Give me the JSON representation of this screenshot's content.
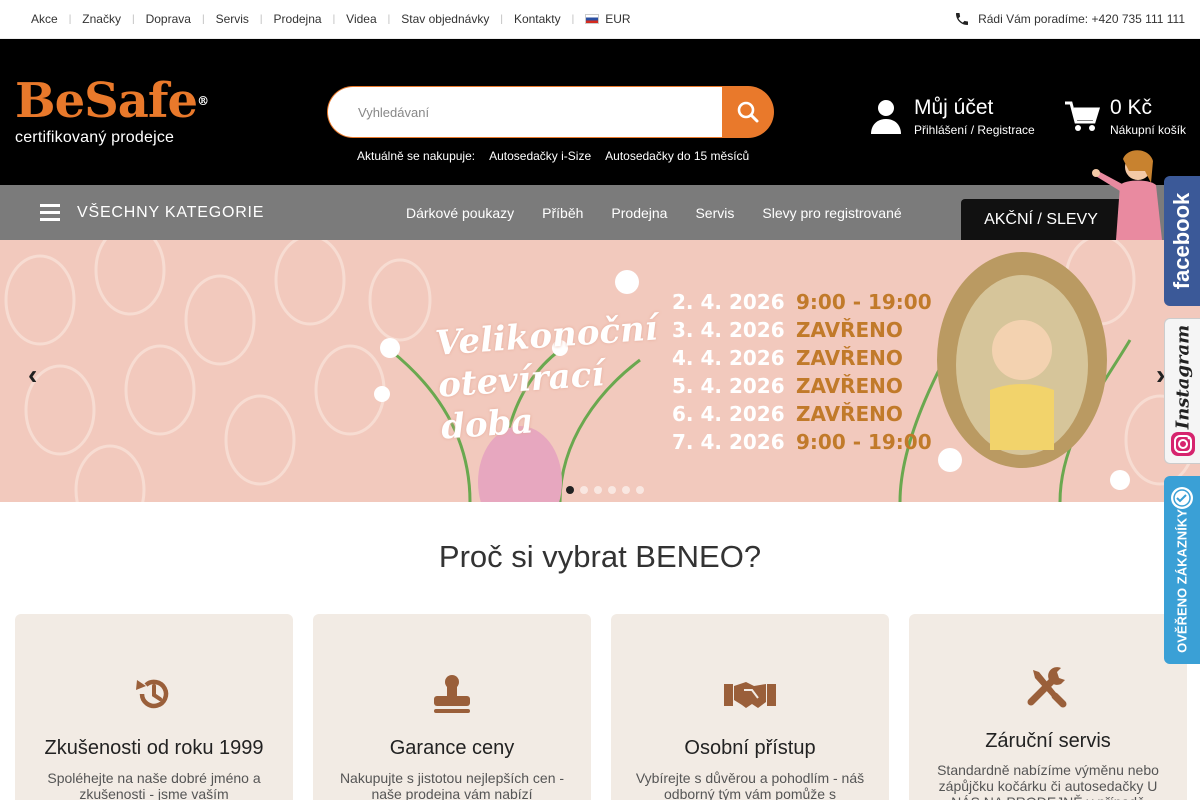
{
  "topbar": {
    "nav": [
      "Akce",
      "Značky",
      "Doprava",
      "Servis",
      "Prodejna",
      "Videa",
      "Stav objednávky",
      "Kontakty"
    ],
    "currency": "EUR",
    "phone_text": "Rádi Vám poradíme: +420 735 111 111"
  },
  "header": {
    "logo_main": "BeSafe",
    "logo_reg": "®",
    "logo_sub": "certifikovaný prodejce",
    "search_placeholder": "Vyhledávaní",
    "recent_label": "Aktuálně se nakupuje:",
    "recent_links": [
      "Autosedačky i-Size",
      "Autosedačky do 15 měsíců"
    ],
    "account_title": "Můj účet",
    "account_sub": "Přihlášení / Registrace",
    "cart_title": "0 Kč",
    "cart_sub": "Nákupní košík"
  },
  "catbar": {
    "all_categories": "VŠECHNY KATEGORIE",
    "items": [
      "Dárkové poukazy",
      "Příběh",
      "Prodejna",
      "Servis",
      "Slevy pro registrované"
    ],
    "sale": "AKČNÍ / SLEVY"
  },
  "banner": {
    "title_lines": [
      "Velikonoční",
      "otevírací",
      "doba"
    ],
    "schedule": [
      {
        "date": "2. 4. 2026",
        "time": "9:00 - 19:00"
      },
      {
        "date": "3. 4. 2026",
        "time": "ZAVŘENO"
      },
      {
        "date": "4. 4. 2026",
        "time": "ZAVŘENO"
      },
      {
        "date": "5. 4. 2026",
        "time": "ZAVŘENO"
      },
      {
        "date": "6. 4. 2026",
        "time": "ZAVŘENO"
      },
      {
        "date": "7. 4. 2026",
        "time": "9:00 - 19:00"
      }
    ],
    "slide_count": 6,
    "active_slide": 1
  },
  "why": {
    "title": "Proč si vybrat BENEO?",
    "cards": [
      {
        "icon": "history-icon",
        "title": "Zkušenosti od roku 1999",
        "text": "Spoléhejte na naše dobré jméno a zkušenosti - jsme vaším"
      },
      {
        "icon": "stamp-icon",
        "title": "Garance ceny",
        "text": "Nakupujte s jistotou nejlepších cen - naše prodejna vám nabízí"
      },
      {
        "icon": "handshake-icon",
        "title": "Osobní přístup",
        "text": "Vybírejte s důvěrou a pohodlím - náš odborný tým vám pomůže s"
      },
      {
        "icon": "tools-icon",
        "title": "Záruční servis",
        "text": "Standardně nabízíme výměnu nebo zápůjčku kočárku či autosedačky U NÁS NA PRODEJNĚ v případě"
      }
    ]
  },
  "side": {
    "facebook": "facebook",
    "instagram": "Instagram",
    "verified": "OVĚŘENO ZÁKAZNÍKY"
  },
  "colors": {
    "accent": "#e9792b",
    "header_bg": "#000000",
    "catbar_bg": "#7b7b7b",
    "banner_bg": "#f2c9bd",
    "card_bg": "#f2ebe4",
    "icon_color": "#9a5f3a",
    "facebook_bg": "#3b5998",
    "verified_bg": "#3aa0d6"
  }
}
